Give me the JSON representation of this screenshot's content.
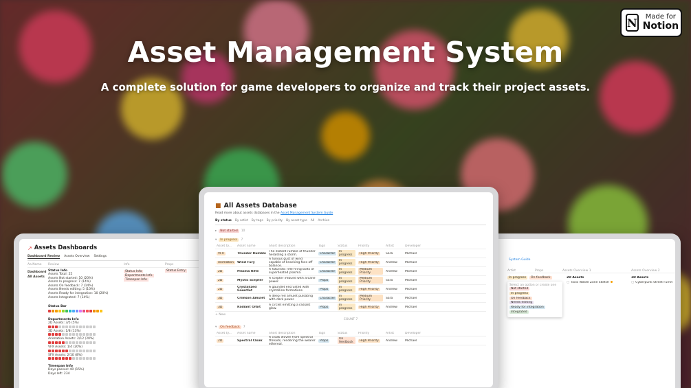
{
  "badge": {
    "made_for": "Made for",
    "brand": "Notion"
  },
  "hero": {
    "title": "Asset Management System",
    "subtitle": "A complete solution for game developers to organize and track their project assets."
  },
  "left": {
    "title": "Assets Dashboards",
    "tabs": [
      "Dashboard Review",
      "Assets Overview",
      "Settings"
    ],
    "cols": [
      "Aa Name",
      "Review",
      "Info",
      "Props"
    ],
    "nav": [
      "Dashboard",
      "All Assets"
    ],
    "status_title": "Status Info",
    "status_lines": [
      "Assets Total: 55",
      "Assets Not started: 10 (20%)",
      "Assets In progress: 7 (14%)",
      "Assets On feedback: 7 (14%)",
      "Assets Needs editing: 5 (10%)",
      "Assets Ready for integration: 10 (20%)",
      "Assets Integrated: 7 (14%)"
    ],
    "status_bar": "Status Bar",
    "dept_title": "Departments Info",
    "dept_lines": [
      "2D Assets: 3/5 (5%)",
      "3D Assets: 1/8 (13%)",
      "Animation Assets: 2/12 (20%)",
      "VFX Assets: 1/4 (20%)",
      "SFX Assets: 2/10 (8%)"
    ],
    "time_title": "Timespan Info",
    "time_lines": [
      "Days passed: 40 (15%)",
      "Days left: 234"
    ],
    "col2": [
      "Status Info",
      "Departments Info",
      "Timespan Info"
    ],
    "col2b": [
      "Status Bar"
    ],
    "col3": [
      "Status Entry"
    ]
  },
  "mid": {
    "title": "All Assets Database",
    "intro": "Read more about assets databases in the",
    "guide": "Asset Management System Guide",
    "views": [
      "By status",
      "By artist",
      "By tags",
      "By priority",
      "By asset type",
      "All",
      "Archive"
    ],
    "group_ns": "Not started",
    "group_ns_count": "10",
    "group_ip": "In progress",
    "group_ip_count": "7",
    "group_of": "On feedback",
    "group_of_count": "7",
    "headers": [
      "Asset ty...",
      "Asset name",
      "Short description",
      "Tags",
      "Status",
      "Priority",
      "Artist",
      "Developer"
    ],
    "rows": [
      {
        "type": "VFX",
        "name": "Thunder Rumble",
        "desc": "The distant rumble of thunder heralding a storm.",
        "tags": "Character",
        "status": "In progress",
        "prio": "High Priority",
        "artist": "Sara",
        "dev": "Michael"
      },
      {
        "type": "Animation",
        "name": "Wind Fury",
        "desc": "A furious gust of wind capable of knocking foes off balance.",
        "tags": "Character",
        "status": "In progress",
        "prio": "High Priority",
        "artist": "Andrew",
        "dev": "Michael"
      },
      {
        "type": "2D",
        "name": "Plasma Rifle",
        "desc": "A futuristic rifle firing bolts of superheated plasma.",
        "tags": "Character",
        "status": "In progress",
        "prio": "Medium Priority",
        "artist": "Andrew",
        "dev": "Michael"
      },
      {
        "type": "2D",
        "name": "Mystic Scepter",
        "desc": "A scepter imbued with arcane power.",
        "tags": "Props",
        "status": "In progress",
        "prio": "Medium Priority",
        "artist": "Sara",
        "dev": "Michael"
      },
      {
        "type": "2D",
        "name": "Crystalized Gauntlet",
        "desc": "A gauntlet encrusted with crystalline formations.",
        "tags": "Props",
        "status": "In progress",
        "prio": "High Priority",
        "artist": "Andrew",
        "dev": "Michael"
      },
      {
        "type": "3D",
        "name": "Crimson Amulet",
        "desc": "A deep red amulet pulsating with dark power.",
        "tags": "Character",
        "status": "In progress",
        "prio": "Medium Priority",
        "artist": "Sara",
        "dev": "Michael"
      },
      {
        "type": "3D",
        "name": "Radiant Orbit",
        "desc": "A circlet emitting a radiant glow.",
        "tags": "Props",
        "status": "In progress",
        "prio": "High Priority",
        "artist": "Andrew",
        "dev": "Michael"
      }
    ],
    "new_label": "+ New",
    "count_label": "COUNT 7",
    "of_row": {
      "type": "2D",
      "name": "Spectral Cloak",
      "desc": "A cloak woven from spectral threads, rendering the wearer ethereal.",
      "tags": "Props",
      "status": "On feedback",
      "prio": "High Priority",
      "artist": "Andrew",
      "dev": "Michael"
    }
  },
  "right": {
    "guide": "System Guide",
    "cols": [
      "Artist",
      "Props",
      "Assets Overview 1",
      "Assets Overview 2"
    ],
    "filters": [
      "In progress",
      "On feedback"
    ],
    "dd_hint": "Select an option or create one",
    "dd": [
      "Not started",
      "In progress",
      "On feedback",
      "Needs editing",
      "Ready for integration",
      "Integrated"
    ],
    "list1_head": "2D Assets",
    "list1": [
      "Toxic Waste Zone Sketch",
      "Biomechanical Upgrade Icons",
      "Robotic Pet Companion Animations",
      "Corporate Overlord Avatars",
      "Illegal Cybernetic Workshop Blueprint",
      "Biomechanical Upgrade Icons",
      "Slum Dwelling Concept",
      "Corporate Overlord Avatars",
      "Toxic Waste Zone Sketch",
      "Robotic Pet Companion Animations",
      "Illegal Cybernetic Workshop Blueprint",
      "Corporate Overlord Avatars",
      "Toxic Waste Zone Sketch",
      "Biomechanical Upgrade Icons",
      "Robotic Pet Companion Animations",
      "Corporate Overlord Avatars",
      "Toxic Waste Zone Sketch",
      "Biomechanical Upgrade Icons",
      "Robotic Pet Companion Animations",
      "Corporate Overlord Avatars",
      "Illegal Cybernetic Workshop Blueprint",
      "Biomechanical Upgrade Icons",
      "Robotic Pet Companion Animations",
      "Corporate Overlord Avatars",
      "Toxic Waste Zone Sketch"
    ],
    "list2_head": "3D Assets",
    "list2": [
      "Cyberpunk Street Furniture",
      "Corporate Tower Facade",
      "Drone Patrol Unit",
      "Rogue Hacker Model",
      "Cybernetic Zen Enclosure",
      "Corporate Tower Facade",
      "Slum Dwelling Complex",
      "Alleyway Escape Ladder",
      "Rogue Hacker Model",
      "Cybernetic Zen Enclosure",
      "Drone Patrol Unit",
      "Corporate Tower Facade",
      "Rogue Hacker Model",
      "Cyberpunk Street Furniture",
      "Corporate Tower Facade",
      "Alleyway Escape Ladder",
      "Rogue Hacker Model",
      "Cybernetic Zen Enclosure",
      "Drone Patrol Unit",
      "Cyberpunk Street Furniture",
      "Corporate Tower Facade",
      "Alleyway Escape Ladder",
      "Cybernetic Zen Enclosure",
      "Cyberpunk Street Furniture",
      "Drone Patrol Unit"
    ]
  },
  "colors": {
    "ns": "#f9d7d5",
    "ip": "#fbe8c4",
    "of": "#ffe0d0",
    "prio": "#fde2c4",
    "tag": "#d3e5ef",
    "blue": "#2383e2"
  }
}
